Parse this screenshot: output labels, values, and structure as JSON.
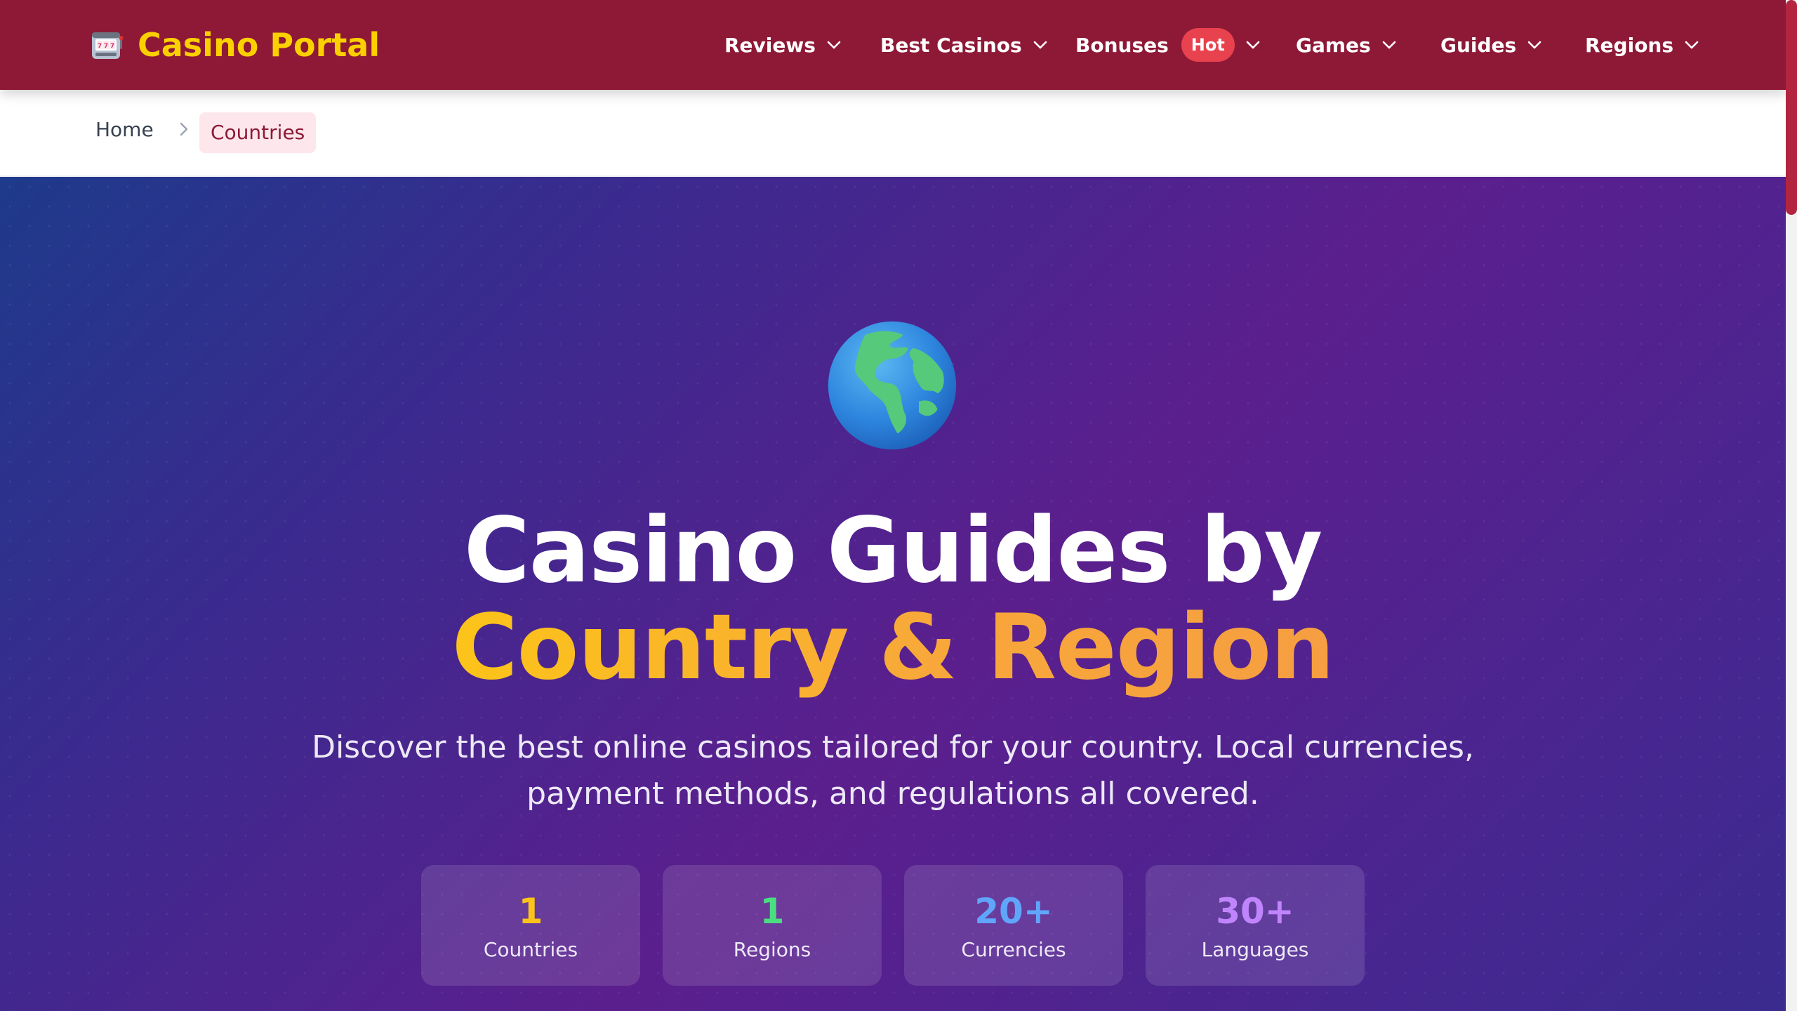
{
  "header": {
    "brand": "Casino Portal",
    "brand_icon": "slot-machine-icon",
    "nav": [
      {
        "label": "Reviews"
      },
      {
        "label": "Best Casinos"
      },
      {
        "label": "Bonuses",
        "badge": "Hot"
      },
      {
        "label": "Games"
      },
      {
        "label": "Guides"
      },
      {
        "label": "Regions"
      }
    ],
    "colors": {
      "bar": "#8e1937",
      "brand": "#fbd000",
      "badge": "#e8424e"
    }
  },
  "breadcrumb": {
    "home": "Home",
    "current": "Countries"
  },
  "hero": {
    "icon": "globe-icon",
    "title_line1": "Casino Guides by",
    "title_line2": "Country & Region",
    "subtitle": "Discover the best online casinos tailored for your country. Local currencies, payment methods, and regulations all covered.",
    "stats": [
      {
        "value": "1",
        "label": "Countries",
        "color": "#fcc419"
      },
      {
        "value": "1",
        "label": "Regions",
        "color": "#4ade80"
      },
      {
        "value": "20+",
        "label": "Currencies",
        "color": "#60a5fa"
      },
      {
        "value": "30+",
        "label": "Languages",
        "color": "#c084fc"
      }
    ]
  }
}
